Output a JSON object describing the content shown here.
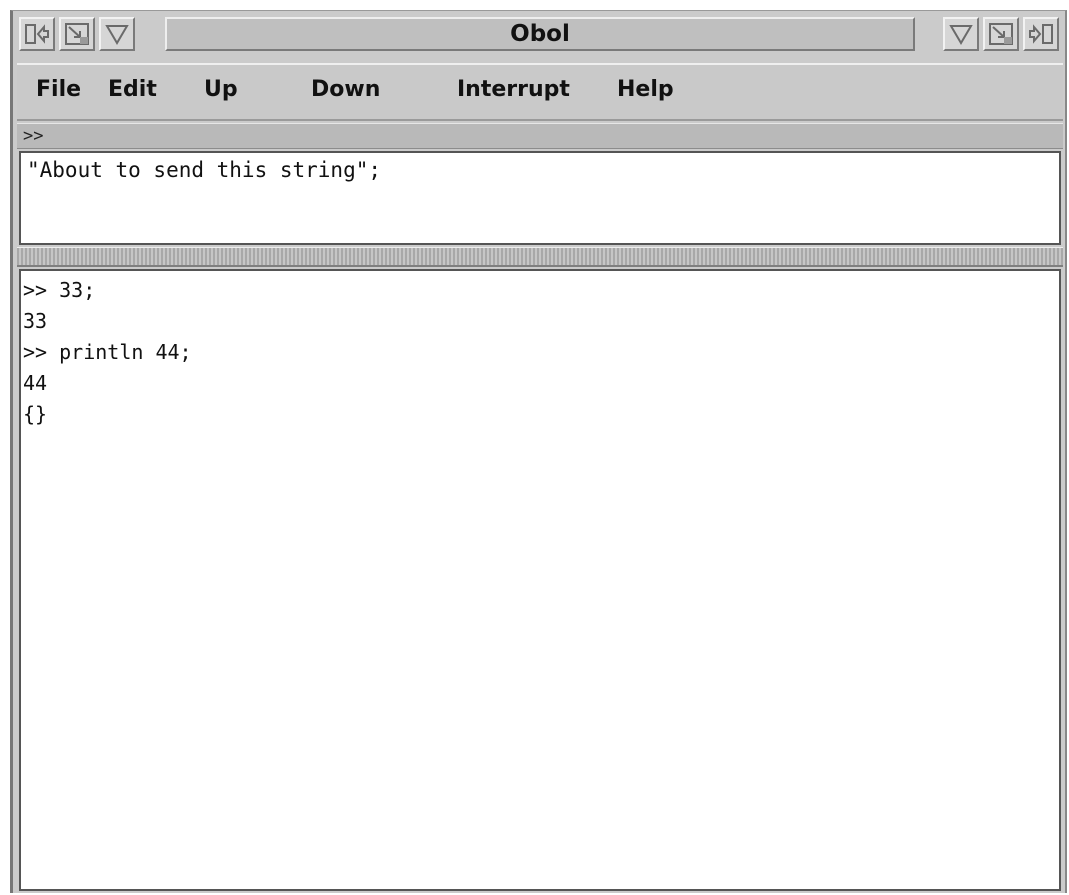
{
  "window": {
    "title": "Obol"
  },
  "titlebar": {
    "left_buttons": [
      "window-menu-icon",
      "resize-icon",
      "minimize-icon"
    ],
    "right_buttons": [
      "minimize-icon",
      "resize-icon",
      "window-menu-icon"
    ]
  },
  "menu": {
    "items": [
      {
        "label": "File"
      },
      {
        "label": "Edit"
      },
      {
        "label": "Up"
      },
      {
        "label": "Down"
      },
      {
        "label": "Interrupt"
      },
      {
        "label": "Help"
      }
    ]
  },
  "prompt": {
    "text": ">>"
  },
  "input": {
    "value": "\"About to send this string\";"
  },
  "output": {
    "lines": [
      ">> 33;",
      "33",
      ">> println 44;",
      "44",
      "{}"
    ]
  },
  "colors": {
    "chrome": "#cbcbcb",
    "text_area_background": "#ffffff",
    "text": "#111111"
  }
}
